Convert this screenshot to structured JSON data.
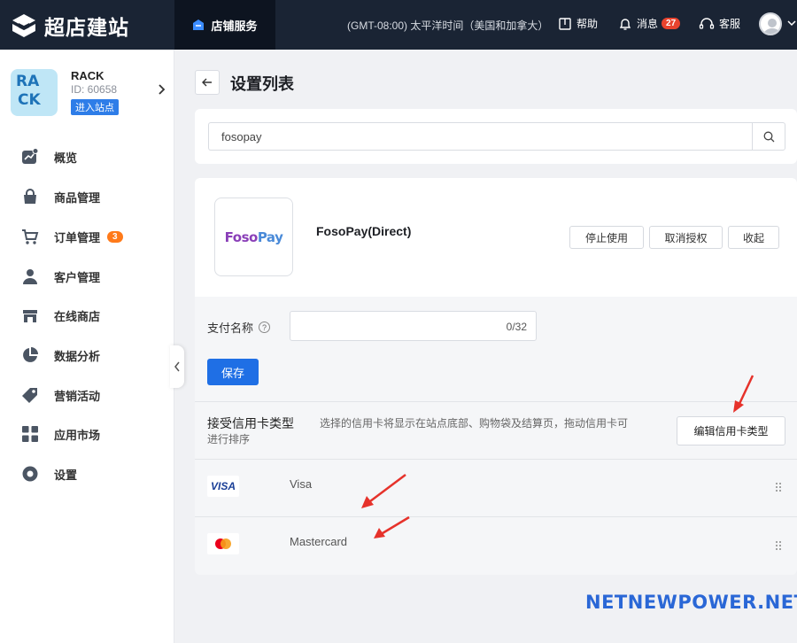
{
  "topbar": {
    "logo_text": "超店建站",
    "active_tab": "店铺服务",
    "timezone": "(GMT-08:00) 太平洋时间（美国和加拿大）",
    "help": "帮助",
    "messages": "消息",
    "messages_count": "27",
    "support": "客服"
  },
  "store": {
    "logo_text": "RACK",
    "name": "RACK",
    "id": "ID: 60658",
    "enter_label": "进入站点"
  },
  "sidebar": {
    "items": [
      {
        "label": "概览",
        "icon": "overview-icon"
      },
      {
        "label": "商品管理",
        "icon": "bag-icon"
      },
      {
        "label": "订单管理",
        "icon": "cart-icon",
        "badge": "3"
      },
      {
        "label": "客户管理",
        "icon": "user-icon"
      },
      {
        "label": "在线商店",
        "icon": "store-icon"
      },
      {
        "label": "数据分析",
        "icon": "pie-chart-icon"
      },
      {
        "label": "营销活动",
        "icon": "tag-icon"
      },
      {
        "label": "应用市场",
        "icon": "apps-icon"
      },
      {
        "label": "设置",
        "icon": "settings-icon"
      }
    ]
  },
  "page": {
    "title": "设置列表"
  },
  "search": {
    "value": "fosopay"
  },
  "payment": {
    "logo_text_a": "Foso",
    "logo_text_b": "Pay",
    "name": "FosoPay(Direct)",
    "btn_disable": "停止使用",
    "btn_unauthorize": "取消授权",
    "btn_collapse": "收起",
    "name_label": "支付名称",
    "name_help": "?",
    "name_value": "",
    "name_count": "0/32",
    "save_label": "保存",
    "cc_title": "接受信用卡类型",
    "cc_desc": "选择的信用卡将显示在站点底部、购物袋及结算页，拖动信用卡可进行排序",
    "cc_edit_label": "编辑信用卡类型",
    "cards": [
      {
        "name": "Visa",
        "logo": "VISA"
      },
      {
        "name": "Mastercard",
        "logo": "mastercard-logo"
      }
    ]
  },
  "watermark": "NETNEWPOWER.NET",
  "colors": {
    "topbar": "#1a2434",
    "primary": "#1f6fe5",
    "badge_red": "#e8432e",
    "badge_orange": "#ff7a1a",
    "arrow": "#e6322b"
  }
}
